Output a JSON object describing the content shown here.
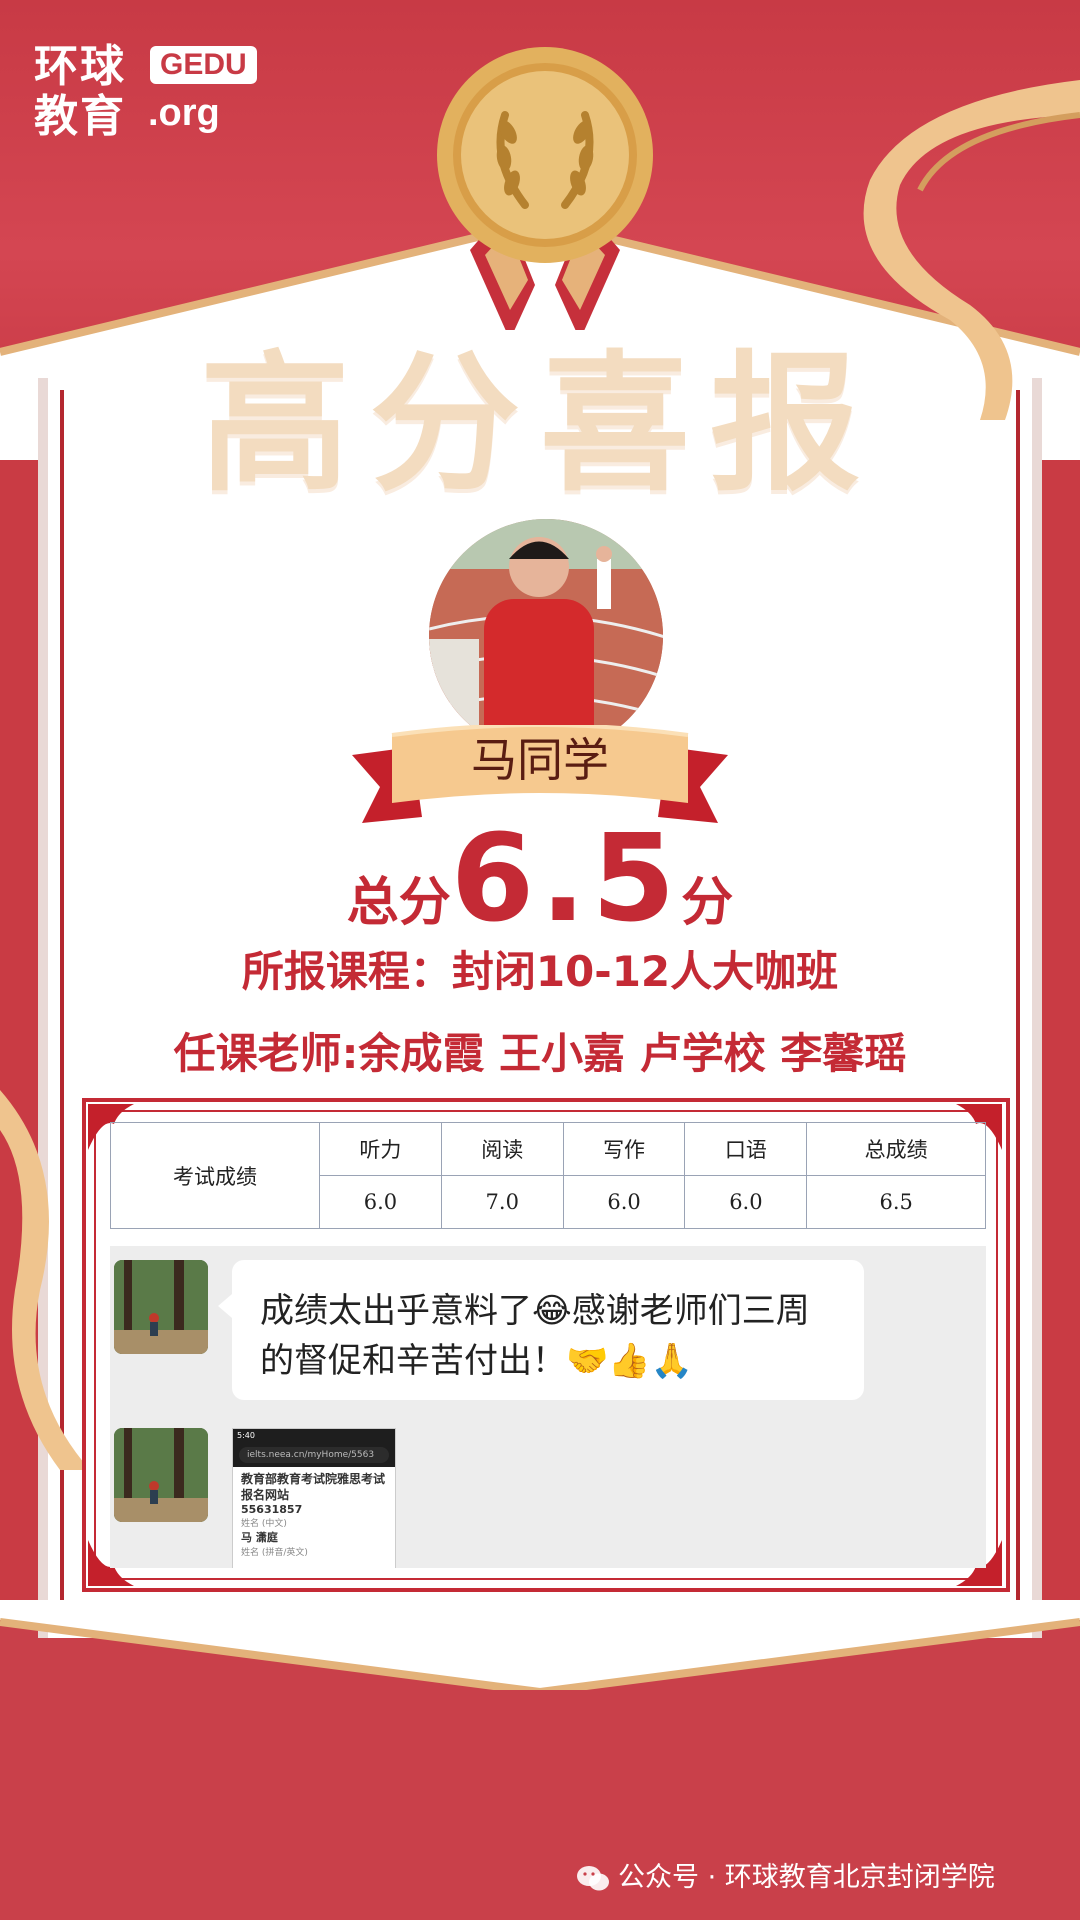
{
  "logo": {
    "cn_text": "环球\n教育",
    "brand": "GEDU",
    "suffix": ".org"
  },
  "headline": "高分喜报",
  "student": {
    "name": "马同学"
  },
  "score": {
    "prefix": "总分",
    "value": "6.5",
    "suffix": "分"
  },
  "course": "所报课程：封闭10-12人大咖班",
  "teachers": "任课老师:余成霞 王小嘉 卢学校 李馨瑶",
  "score_table": {
    "row_label": "考试成绩",
    "headers": [
      "听力",
      "阅读",
      "写作",
      "口语",
      "总成绩"
    ],
    "values": [
      "6.0",
      "7.0",
      "6.0",
      "6.0",
      "6.5"
    ]
  },
  "chat": {
    "message": "成绩太出乎意料了😂感谢老师们三周的督促和辛苦付出！🤝👍🙏",
    "screenshot": {
      "time": "5:40",
      "url": "ielts.neea.cn/myHome/5563",
      "title": "教育部教育考试院雅思考试报名网站",
      "id": "55631857",
      "id_label": "姓名 (中文)",
      "name": "马 潇庭",
      "name_label": "姓名 (拼音/英文)"
    }
  },
  "footer": {
    "wechat_label": "公众号 · 环球教育北京封闭学院"
  },
  "colors": {
    "primary_red": "#c42a35",
    "gold": "#d8a25c",
    "background_red": "#c93b44"
  }
}
